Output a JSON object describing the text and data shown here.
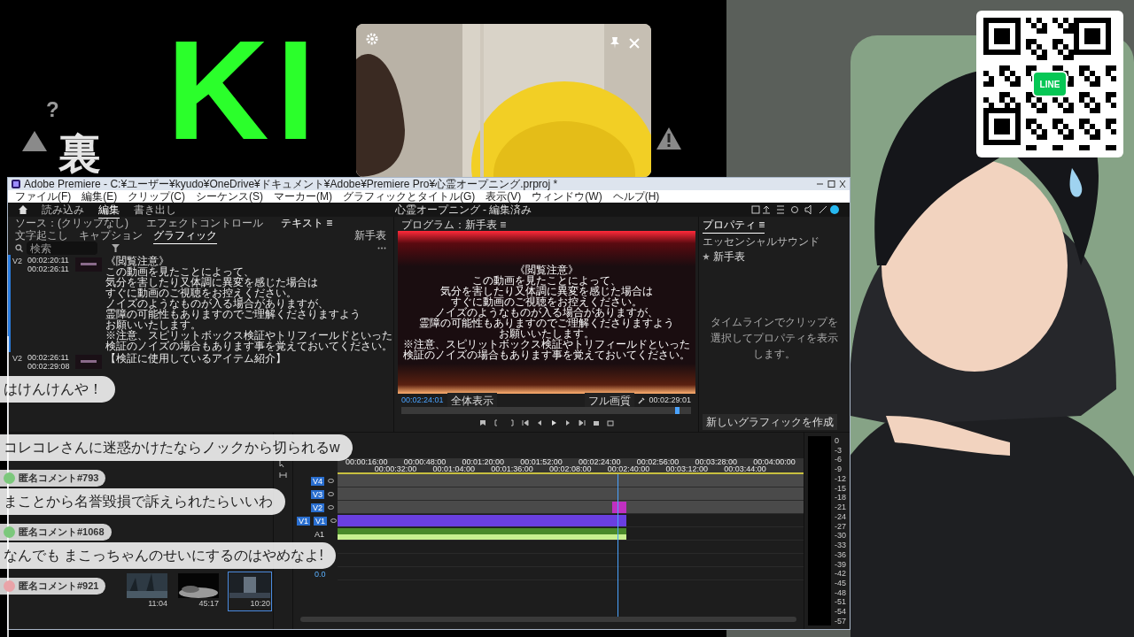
{
  "overlay": {
    "logo": "KI",
    "kanji": "裏",
    "question": "?",
    "qr_badge": "LINE"
  },
  "premiere": {
    "title": "Adobe Premiere - C:¥ユーザー¥kyudo¥OneDrive¥ドキュメント¥Adobe¥Premiere Pro¥心霊オープニング.prproj *",
    "menu": [
      "ファイル(F)",
      "編集(E)",
      "クリップ(C)",
      "シーケンス(S)",
      "マーカー(M)",
      "グラフィックとタイトル(G)",
      "表示(V)",
      "ウィンドウ(W)",
      "ヘルプ(H)"
    ],
    "workspaces": [
      {
        "label": "読み込み",
        "selected": false
      },
      {
        "label": "編集",
        "selected": true
      },
      {
        "label": "書き出し",
        "selected": false
      }
    ],
    "project_title": "心霊オープニング - 編集済み",
    "left_panel": {
      "tabs": [
        {
          "label": "ソース：(クリップなし)",
          "selected": false
        },
        {
          "label": "エフェクトコントロール",
          "selected": false
        },
        {
          "label": "テキスト ≡",
          "selected": true
        }
      ],
      "subtabs": [
        {
          "label": "文字起こし",
          "selected": false
        },
        {
          "label": "キャプション",
          "selected": false
        },
        {
          "label": "グラフィック",
          "selected": true
        }
      ],
      "track_label": "新手表",
      "search": {
        "placeholder": "検索"
      },
      "captions": [
        {
          "track": "V2",
          "start": "00:02:20:11",
          "end": "00:02:26:11",
          "selected": true,
          "lines": [
            "《閲覧注意》",
            "この動画を見たことによって、",
            "気分を害したり又体調に異変を感じた場合は",
            "すぐに動画のご視聴をお控えください。",
            "ノイズのようなものが入る場合がありますが、",
            "霊障の可能性もありますのでご理解くださりますよう",
            "お願いいたします。",
            "※注意、スピリットボックス検証やトリフィールドといった",
            "検証のノイズの場合もあります事を覚えておいてください。"
          ]
        },
        {
          "track": "V2",
          "start": "00:02:26:11",
          "end": "00:02:29:08",
          "selected": false,
          "lines": [
            "【検証に使用しているアイテム紹介】"
          ]
        }
      ]
    },
    "monitor": {
      "tab": "プログラム：新手表 ≡",
      "subtitle": [
        "《閲覧注意》",
        "この動画を見たことによって、",
        "気分を害したり又体調に異変を感じた場合は",
        "すぐに動画のご視聴をお控えください。",
        "ノイズのようなものが入る場合がありますが、",
        "霊障の可能性もありますのでご理解くださりますよう",
        "お願いいたします。",
        "※注意、スピリットボックス検証やトリフィールドといった",
        "検証のノイズの場合もあります事を覚えておいてください。"
      ],
      "timecode": "00:02:24:01",
      "zoom": "全体表示",
      "quality": "フル画質",
      "duration": "00:02:29:01",
      "scrub": {
        "level": 0.96
      }
    },
    "properties": {
      "tabs": [
        {
          "label": "プロパティ ≡",
          "selected": true
        },
        {
          "label": "エッセンシャルサウンド",
          "selected": false
        }
      ],
      "item": "新手表",
      "message": "タイムラインでクリップを選択してプロパティを表示します。",
      "button": "新しいグラフィックを作成"
    },
    "project": {
      "clips": [
        {
          "duration": "11:04"
        },
        {
          "duration": "45:17"
        },
        {
          "duration": "10:20",
          "selected": true
        }
      ]
    },
    "timeline": {
      "ruler": [
        "00:00:16:00",
        "00:00:32:00",
        "00:00:48:00",
        "00:01:04:00",
        "00:01:20:00",
        "00:01:36:00",
        "00:01:52:00",
        "00:02:08:00",
        "00:02:24:00",
        "00:02:40:00",
        "00:02:56:00",
        "00:03:12:00",
        "00:03:28:00",
        "00:03:44:00",
        "00:04:00:00"
      ],
      "tracks": [
        {
          "kind": "video",
          "label": "V4"
        },
        {
          "kind": "video",
          "label": "V3"
        },
        {
          "kind": "video",
          "label": "V2"
        },
        {
          "kind": "video",
          "label": "V1",
          "source": "V1"
        },
        {
          "kind": "audio",
          "label": "A1"
        },
        {
          "kind": "audio"
        },
        {
          "kind": "audio"
        },
        {
          "kind": "mix",
          "label": "0.0"
        }
      ],
      "meter_scale": [
        "0",
        "-3",
        "-6",
        "-9",
        "-12",
        "-15",
        "-18",
        "-21",
        "-24",
        "-27",
        "-30",
        "-33",
        "-36",
        "-39",
        "-42",
        "-45",
        "-48",
        "-51",
        "-54",
        "-57"
      ]
    }
  },
  "chat": [
    {
      "kind": "message",
      "text": "はけんけんや！"
    },
    {
      "kind": "message",
      "text": "コレコレさんに迷惑かけたならノックから切られるw"
    },
    {
      "kind": "name",
      "text": "匿名コメント#793",
      "color": "#7cc87c"
    },
    {
      "kind": "message",
      "text": "まことから名誉毀損で訴えられたらいいわ"
    },
    {
      "kind": "name",
      "text": "匿名コメント#1068",
      "color": "#7cc87c"
    },
    {
      "kind": "message",
      "text": "なんでも まこっちゃんのせいにするのはやめなよ!"
    },
    {
      "kind": "name",
      "text": "匿名コメント#921",
      "color": "#e9a3a8"
    }
  ]
}
